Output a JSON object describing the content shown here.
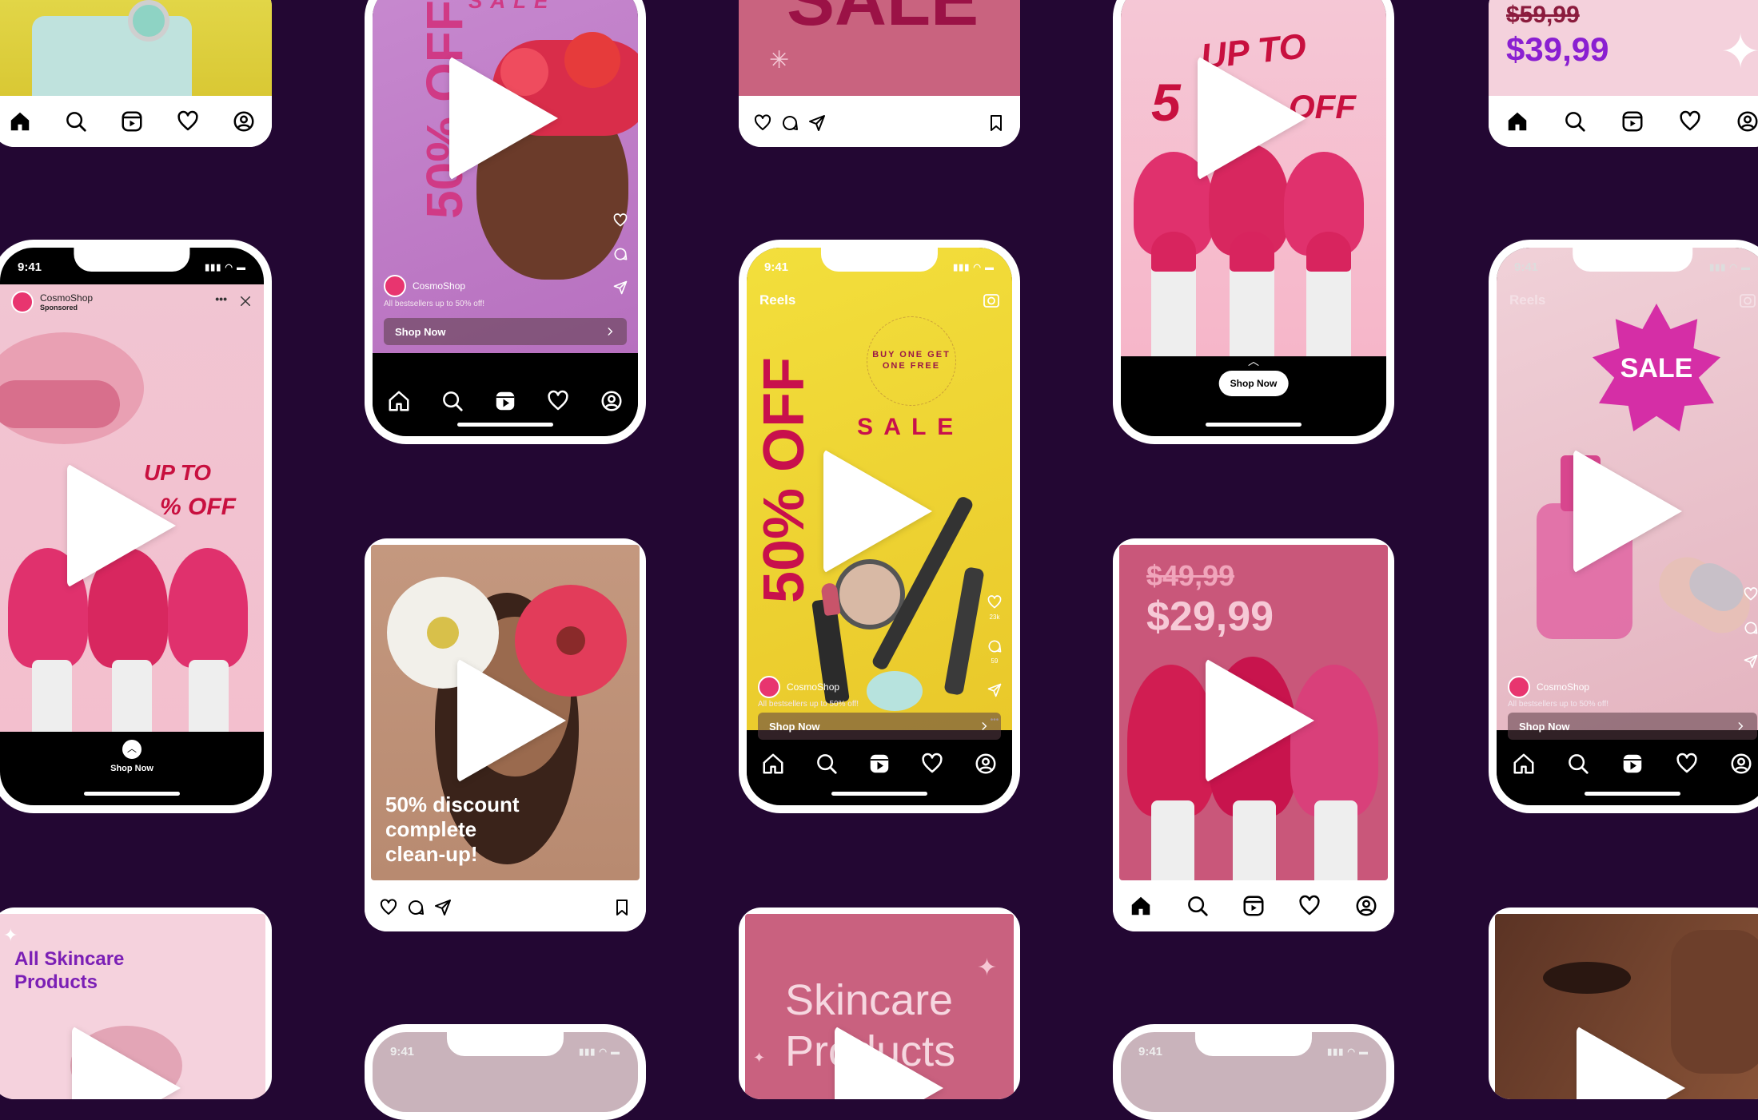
{
  "colors": {
    "background": "#230733",
    "accent_pink": "#e0316d",
    "purple_text": "#8a1fd1",
    "yellow": "#f1d42e"
  },
  "status_time": "9:41",
  "reels_label": "Reels",
  "brand": {
    "name": "CosmoShop",
    "sponsored": "Sponsored"
  },
  "caption": "All bestsellers up to 50% off!",
  "shop_now": "Shop Now",
  "promo": {
    "sale": "SALE",
    "sale_spaced": "S A L E",
    "fifty_off": "50% OFF",
    "up_to": "UP TO",
    "fifty": "5",
    "off": "OFF",
    "up_to_small": "UP TO",
    "off_small": "% OFF",
    "bogo": "BUY ONE GET ONE FREE",
    "old_price_1": "$59,99",
    "new_price_1": "$39,99",
    "old_price_2": "$49,99",
    "new_price_2": "$29,99",
    "discount_line_1": "50% discount",
    "discount_line_2": "complete",
    "discount_line_3": "clean-up!",
    "skincare_line_1": "All Skincare",
    "skincare_line_2": "Products",
    "skincare_big_1": "Skincare",
    "skincare_big_2": "Products"
  },
  "counts": {
    "likes": "23k",
    "comments": "59"
  },
  "icons": [
    "home-icon",
    "search-icon",
    "reels-icon",
    "heart-icon",
    "profile-icon",
    "comment-icon",
    "share-icon",
    "bookmark-icon",
    "camera-icon",
    "close-icon",
    "more-icon",
    "play-icon"
  ]
}
